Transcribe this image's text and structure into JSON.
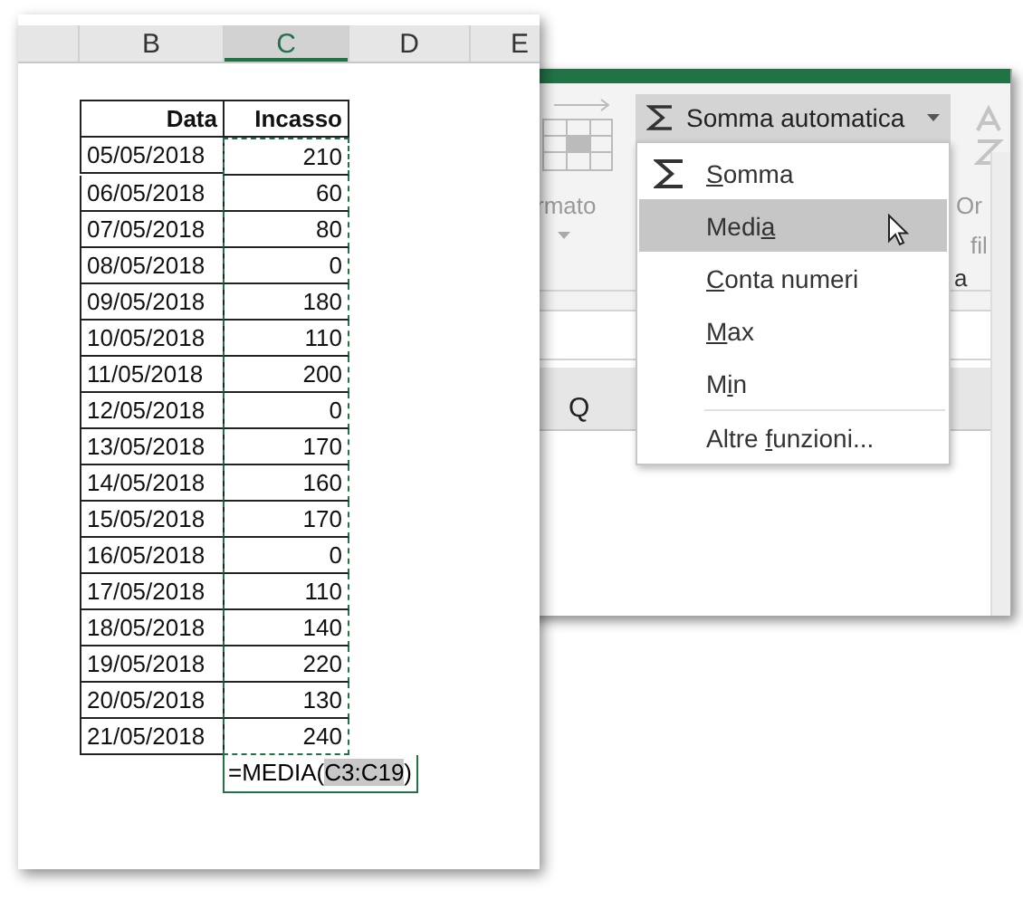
{
  "sheet": {
    "columns": [
      {
        "selected": false
      },
      {
        "label": "B",
        "selected": false
      },
      {
        "label": "C",
        "selected": true
      },
      {
        "label": "D",
        "selected": false
      },
      {
        "label": "E",
        "selected": false
      }
    ],
    "table": {
      "headers": [
        "Data",
        "Incasso"
      ],
      "range_marked": true,
      "rows": [
        [
          "05/05/2018",
          "210"
        ],
        [
          "06/05/2018",
          "60"
        ],
        [
          "07/05/2018",
          "80"
        ],
        [
          "08/05/2018",
          "0"
        ],
        [
          "09/05/2018",
          "180"
        ],
        [
          "10/05/2018",
          "110"
        ],
        [
          "11/05/2018",
          "200"
        ],
        [
          "12/05/2018",
          "0"
        ],
        [
          "13/05/2018",
          "170"
        ],
        [
          "14/05/2018",
          "160"
        ],
        [
          "15/05/2018",
          "170"
        ],
        [
          "16/05/2018",
          "0"
        ],
        [
          "17/05/2018",
          "110"
        ],
        [
          "18/05/2018",
          "140"
        ],
        [
          "19/05/2018",
          "220"
        ],
        [
          "20/05/2018",
          "130"
        ],
        [
          "21/05/2018",
          "240"
        ]
      ],
      "formula": [
        {
          "text": "=MEDIA("
        },
        {
          "text": "C3:C19",
          "highlight": true
        },
        {
          "text": ")"
        }
      ]
    }
  },
  "ribbon": {
    "partial_labels": [
      "rmato",
      "Or",
      "fil",
      "a"
    ],
    "autosum_button": {
      "label": "Somma automatica"
    },
    "menu": [
      {
        "label": [
          {
            "text": "S",
            "key": true
          },
          {
            "text": "omma"
          }
        ],
        "kind": "sum",
        "selected": false
      },
      {
        "label": [
          {
            "text": "Medi"
          },
          {
            "text": "a",
            "key": true
          }
        ],
        "selected": true
      },
      {
        "label": [
          {
            "text": "C",
            "key": true
          },
          {
            "text": "onta numeri"
          }
        ],
        "selected": false
      },
      {
        "label": [
          {
            "text": "M",
            "key": true
          },
          {
            "text": "ax"
          }
        ],
        "selected": false
      },
      {
        "label": [
          {
            "text": "M"
          },
          {
            "text": "i",
            "key": true
          },
          {
            "text": "n"
          }
        ],
        "selected": false
      },
      {
        "label": [
          {
            "text": "Altre "
          },
          {
            "text": "f",
            "key": true
          },
          {
            "text": "unzioni..."
          }
        ],
        "selected": false,
        "separator_before": true
      }
    ],
    "column_header": "Q"
  }
}
